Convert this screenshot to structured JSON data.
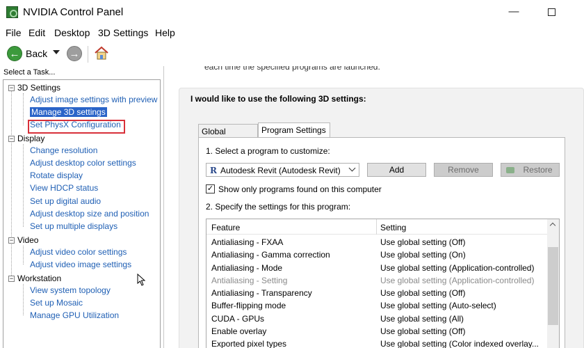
{
  "window": {
    "title": "NVIDIA Control Panel",
    "minimize_symbol": "—",
    "maximize_symbol": "□"
  },
  "menu": [
    "File",
    "Edit",
    "Desktop",
    "3D Settings",
    "Help"
  ],
  "toolbar": {
    "back_label": "Back",
    "back_icon": "arrow-left-icon",
    "forward_icon": "arrow-right-icon",
    "home_icon": "home-icon"
  },
  "left_panel": {
    "header": "Select a Task...",
    "categories": [
      {
        "label": "3D Settings",
        "expander": "⊟",
        "items": [
          {
            "label": "Adjust image settings with preview",
            "selected": false
          },
          {
            "label": "Manage 3D settings",
            "selected": true
          },
          {
            "label": "Set PhysX Configuration",
            "selected": false
          }
        ]
      },
      {
        "label": "Display",
        "expander": "⊟",
        "items": [
          {
            "label": "Change resolution"
          },
          {
            "label": "Adjust desktop color settings"
          },
          {
            "label": "Rotate display"
          },
          {
            "label": "View HDCP status"
          },
          {
            "label": "Set up digital audio"
          },
          {
            "label": "Adjust desktop size and position"
          },
          {
            "label": "Set up multiple displays"
          }
        ]
      },
      {
        "label": "Video",
        "expander": "⊟",
        "items": [
          {
            "label": "Adjust video color settings"
          },
          {
            "label": "Adjust video image settings"
          }
        ]
      },
      {
        "label": "Workstation",
        "expander": "⊟",
        "items": [
          {
            "label": "View system topology"
          },
          {
            "label": "Set up Mosaic"
          },
          {
            "label": "Manage GPU Utilization"
          }
        ]
      }
    ]
  },
  "main": {
    "top_text": "each time the specified programs are launched.",
    "heading": "I would like to use the following 3D settings:",
    "tabs": [
      {
        "label": "Global Settings",
        "active": false
      },
      {
        "label": "Program Settings",
        "active": true
      }
    ],
    "step1_label": "1. Select a program to customize:",
    "program_selected": "Autodesk Revit (Autodesk Revit)",
    "program_icon": "R",
    "buttons": {
      "add": "Add",
      "remove": "Remove",
      "restore": "Restore"
    },
    "show_only_checkbox": {
      "label": "Show only programs found on this computer",
      "checked": true
    },
    "step2_label": "2. Specify the settings for this program:",
    "grid": {
      "columns": [
        "Feature",
        "Setting"
      ],
      "rows": [
        {
          "feature": "Antialiasing - FXAA",
          "setting": "Use global setting (Off)",
          "disabled": false
        },
        {
          "feature": "Antialiasing - Gamma correction",
          "setting": "Use global setting (On)",
          "disabled": false
        },
        {
          "feature": "Antialiasing - Mode",
          "setting": "Use global setting (Application-controlled)",
          "disabled": false
        },
        {
          "feature": "Antialiasing - Setting",
          "setting": "Use global setting (Application-controlled)",
          "disabled": true
        },
        {
          "feature": "Antialiasing - Transparency",
          "setting": "Use global setting (Off)",
          "disabled": false
        },
        {
          "feature": "Buffer-flipping mode",
          "setting": "Use global setting (Auto-select)",
          "disabled": false
        },
        {
          "feature": "CUDA - GPUs",
          "setting": "Use global setting (All)",
          "disabled": false
        },
        {
          "feature": "Enable overlay",
          "setting": "Use global setting (Off)",
          "disabled": false
        },
        {
          "feature": "Exported pixel types",
          "setting": "Use global setting (Color indexed overlay...",
          "disabled": false
        }
      ]
    }
  },
  "colors": {
    "link": "#1f5fb4",
    "selection": "#2a64c8",
    "highlight_outline": "#d8303a"
  }
}
